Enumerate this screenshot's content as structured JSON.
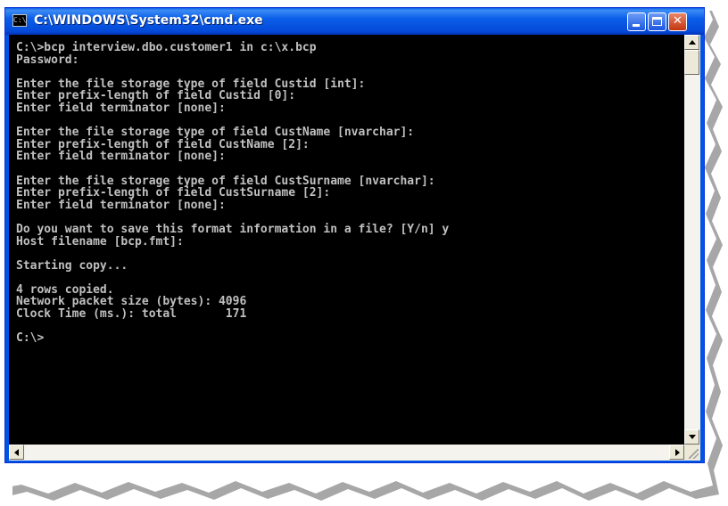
{
  "window": {
    "title": "C:\\WINDOWS\\System32\\cmd.exe",
    "icon": "cmd-icon",
    "icon_text": "C:\\"
  },
  "controls": {
    "minimize": "minimize-icon",
    "maximize": "maximize-icon",
    "close": "close-icon",
    "close_glyph": "✕"
  },
  "console": {
    "lines": [
      "C:\\>bcp interview.dbo.customer1 in c:\\x.bcp",
      "Password:",
      "",
      "Enter the file storage type of field Custid [int]:",
      "Enter prefix-length of field Custid [0]:",
      "Enter field terminator [none]:",
      "",
      "Enter the file storage type of field CustName [nvarchar]:",
      "Enter prefix-length of field CustName [2]:",
      "Enter field terminator [none]:",
      "",
      "Enter the file storage type of field CustSurname [nvarchar]:",
      "Enter prefix-length of field CustSurname [2]:",
      "Enter field terminator [none]:",
      "",
      "Do you want to save this format information in a file? [Y/n] y",
      "Host filename [bcp.fmt]:",
      "",
      "Starting copy...",
      "",
      "4 rows copied.",
      "Network packet size (bytes): 4096",
      "Clock Time (ms.): total       171",
      "",
      "C:\\>"
    ]
  },
  "colors": {
    "console_bg": "#000000",
    "console_fg": "#c0c0c0",
    "titlebar": "#0054e3"
  }
}
